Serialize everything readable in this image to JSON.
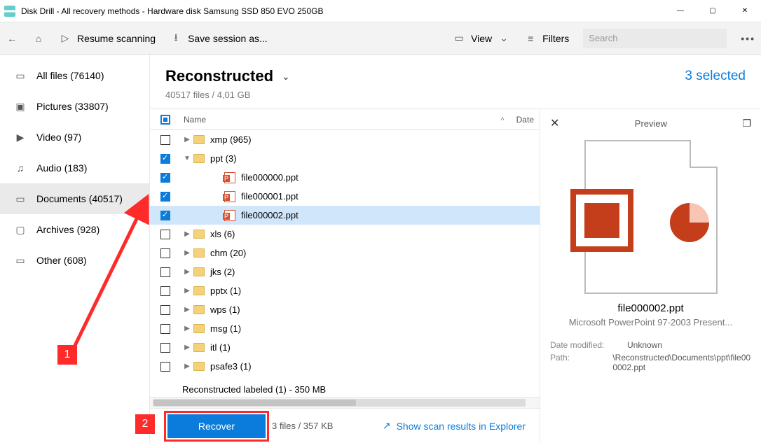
{
  "window": {
    "title": "Disk Drill - All recovery methods - Hardware disk Samsung SSD 850 EVO 250GB"
  },
  "toolbar": {
    "resume": "Resume scanning",
    "save": "Save session as...",
    "view": "View",
    "filters": "Filters",
    "search_placeholder": "Search"
  },
  "sidebar": {
    "items": [
      {
        "label": "All files (76140)"
      },
      {
        "label": "Pictures (33807)"
      },
      {
        "label": "Video (97)"
      },
      {
        "label": "Audio (183)"
      },
      {
        "label": "Documents (40517)"
      },
      {
        "label": "Archives (928)"
      },
      {
        "label": "Other (608)"
      }
    ]
  },
  "header": {
    "title": "Reconstructed",
    "selected_text": "3 selected",
    "stats": "40517 files / 4,01 GB"
  },
  "columns": {
    "name": "Name",
    "date": "Date"
  },
  "rows": [
    {
      "indent": 0,
      "type": "folder",
      "disclosure": "▶",
      "checked": false,
      "label": "xmp (965)"
    },
    {
      "indent": 0,
      "type": "folder",
      "disclosure": "▼",
      "checked": true,
      "label": "ppt (3)"
    },
    {
      "indent": 2,
      "type": "ppt",
      "disclosure": "",
      "checked": true,
      "label": "file000000.ppt"
    },
    {
      "indent": 2,
      "type": "ppt",
      "disclosure": "",
      "checked": true,
      "label": "file000001.ppt"
    },
    {
      "indent": 2,
      "type": "ppt",
      "disclosure": "",
      "checked": true,
      "label": "file000002.ppt",
      "selected": true
    },
    {
      "indent": 0,
      "type": "folder",
      "disclosure": "▶",
      "checked": false,
      "label": "xls (6)"
    },
    {
      "indent": 0,
      "type": "folder",
      "disclosure": "▶",
      "checked": false,
      "label": "chm (20)"
    },
    {
      "indent": 0,
      "type": "folder",
      "disclosure": "▶",
      "checked": false,
      "label": "jks (2)"
    },
    {
      "indent": 0,
      "type": "folder",
      "disclosure": "▶",
      "checked": false,
      "label": "pptx (1)"
    },
    {
      "indent": 0,
      "type": "folder",
      "disclosure": "▶",
      "checked": false,
      "label": "wps (1)"
    },
    {
      "indent": 0,
      "type": "folder",
      "disclosure": "▶",
      "checked": false,
      "label": "msg (1)"
    },
    {
      "indent": 0,
      "type": "folder",
      "disclosure": "▶",
      "checked": false,
      "label": "itl (1)"
    },
    {
      "indent": 0,
      "type": "folder",
      "disclosure": "▶",
      "checked": false,
      "label": "psafe3 (1)"
    }
  ],
  "truncated_row": "Reconstructed labeled (1) - 350 MB",
  "footer": {
    "recover": "Recover",
    "stats": "3 files / 357 KB",
    "show_link": "Show scan results in Explorer"
  },
  "preview": {
    "title": "Preview",
    "name": "file000002.ppt",
    "type": "Microsoft PowerPoint 97-2003 Present...",
    "date_k": "Date modified:",
    "date_v": "Unknown",
    "path_k": "Path:",
    "path_v": "\\Reconstructed\\Documents\\ppt\\file000002.ppt"
  },
  "annotations": {
    "one": "1",
    "two": "2"
  }
}
